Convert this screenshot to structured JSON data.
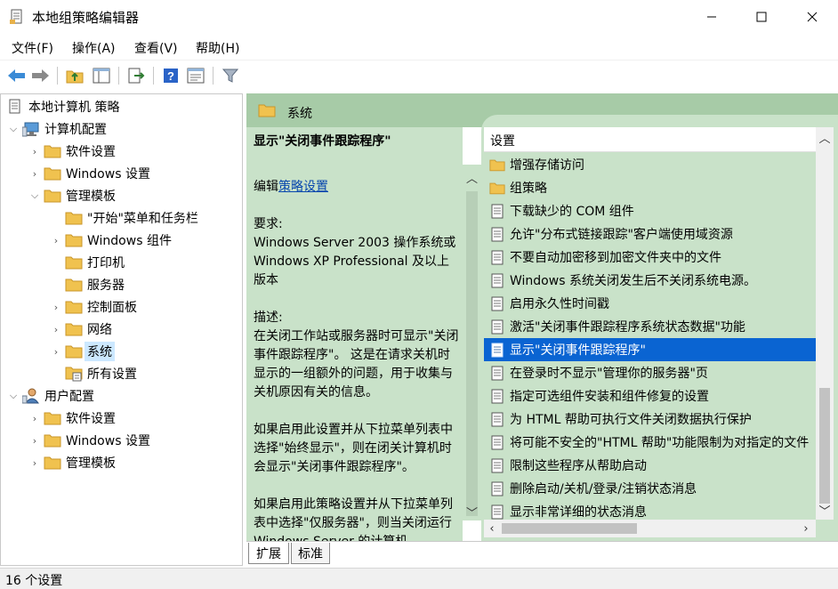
{
  "window": {
    "title": "本地组策略编辑器",
    "controls": {
      "minimize": "—",
      "maximize": "☐",
      "close": "✕"
    }
  },
  "menu": [
    "文件(F)",
    "操作(A)",
    "查看(V)",
    "帮助(H)"
  ],
  "toolbar": [
    "back-arrow-icon",
    "forward-arrow-icon",
    "up-folder-icon",
    "show-hide-tree-icon",
    "export-list-icon",
    "help-icon",
    "properties-icon",
    "filter-icon"
  ],
  "tree": {
    "root": "本地计算机 策略",
    "items": [
      {
        "label": "计算机配置",
        "expanded": true
      },
      {
        "label": "软件设置"
      },
      {
        "label": "Windows 设置"
      },
      {
        "label": "管理模板",
        "expanded": true
      },
      {
        "label": "\"开始\"菜单和任务栏"
      },
      {
        "label": "Windows 组件"
      },
      {
        "label": "打印机"
      },
      {
        "label": "服务器"
      },
      {
        "label": "控制面板"
      },
      {
        "label": "网络"
      },
      {
        "label": "系统",
        "selected": true
      },
      {
        "label": "所有设置"
      },
      {
        "label": "用户配置",
        "expanded": true
      },
      {
        "label": "软件设置"
      },
      {
        "label": "Windows 设置"
      },
      {
        "label": "管理模板"
      }
    ]
  },
  "right_panel": {
    "header": "系统",
    "description": {
      "title": "显示\"关闭事件跟踪程序\"",
      "edit_prefix": "编辑",
      "edit_link": "策略设置",
      "requirements_label": "要求:",
      "requirements_text": "Windows Server 2003 操作系统或 Windows XP Professional 及以上版本",
      "description_label": "描述:",
      "description_text": "在关闭工作站或服务器时可显示\"关闭事件跟踪程序\"。 这是在请求关机时显示的一组额外的问题，用于收集与关机原因有关的信息。",
      "para3": "如果启用此设置并从下拉菜单列表中选择\"始终显示\"，则在闭关计算机时会显示\"关闭事件跟踪程序\"。",
      "para4": "如果启用此策略设置并从下拉菜单列表中选择\"仅服务器\"，则当关闭运行 Windows Server 的计算机"
    },
    "list_header": "设置",
    "settings": [
      {
        "type": "folder",
        "label": "增强存储访问"
      },
      {
        "type": "folder",
        "label": "组策略"
      },
      {
        "type": "setting",
        "label": "下载缺少的 COM 组件"
      },
      {
        "type": "setting",
        "label": "允许\"分布式链接跟踪\"客户端使用域资源"
      },
      {
        "type": "setting",
        "label": "不要自动加密移到加密文件夹中的文件"
      },
      {
        "type": "setting",
        "label": "Windows 系统关闭发生后不关闭系统电源。"
      },
      {
        "type": "setting",
        "label": "启用永久性时间戳"
      },
      {
        "type": "setting",
        "label": "激活\"关闭事件跟踪程序系统状态数据\"功能"
      },
      {
        "type": "setting",
        "label": "显示\"关闭事件跟踪程序\"",
        "selected": true
      },
      {
        "type": "setting",
        "label": "在登录时不显示\"管理你的服务器\"页"
      },
      {
        "type": "setting",
        "label": "指定可选组件安装和组件修复的设置"
      },
      {
        "type": "setting",
        "label": "为 HTML 帮助可执行文件关闭数据执行保护"
      },
      {
        "type": "setting",
        "label": "将可能不安全的\"HTML 帮助\"功能限制为对指定的文件"
      },
      {
        "type": "setting",
        "label": "限制这些程序从帮助启动"
      },
      {
        "type": "setting",
        "label": "删除启动/关机/登录/注销状态消息"
      },
      {
        "type": "setting",
        "label": "显示非常详细的状态消息"
      }
    ],
    "tabs": [
      "扩展",
      "标准"
    ]
  },
  "status": "16 个设置",
  "colors": {
    "accent_green": "#a7cba7",
    "pane_green": "#c9e2c9",
    "selection_blue": "#0a64d2",
    "folder_yellow": "#f0c24f"
  }
}
